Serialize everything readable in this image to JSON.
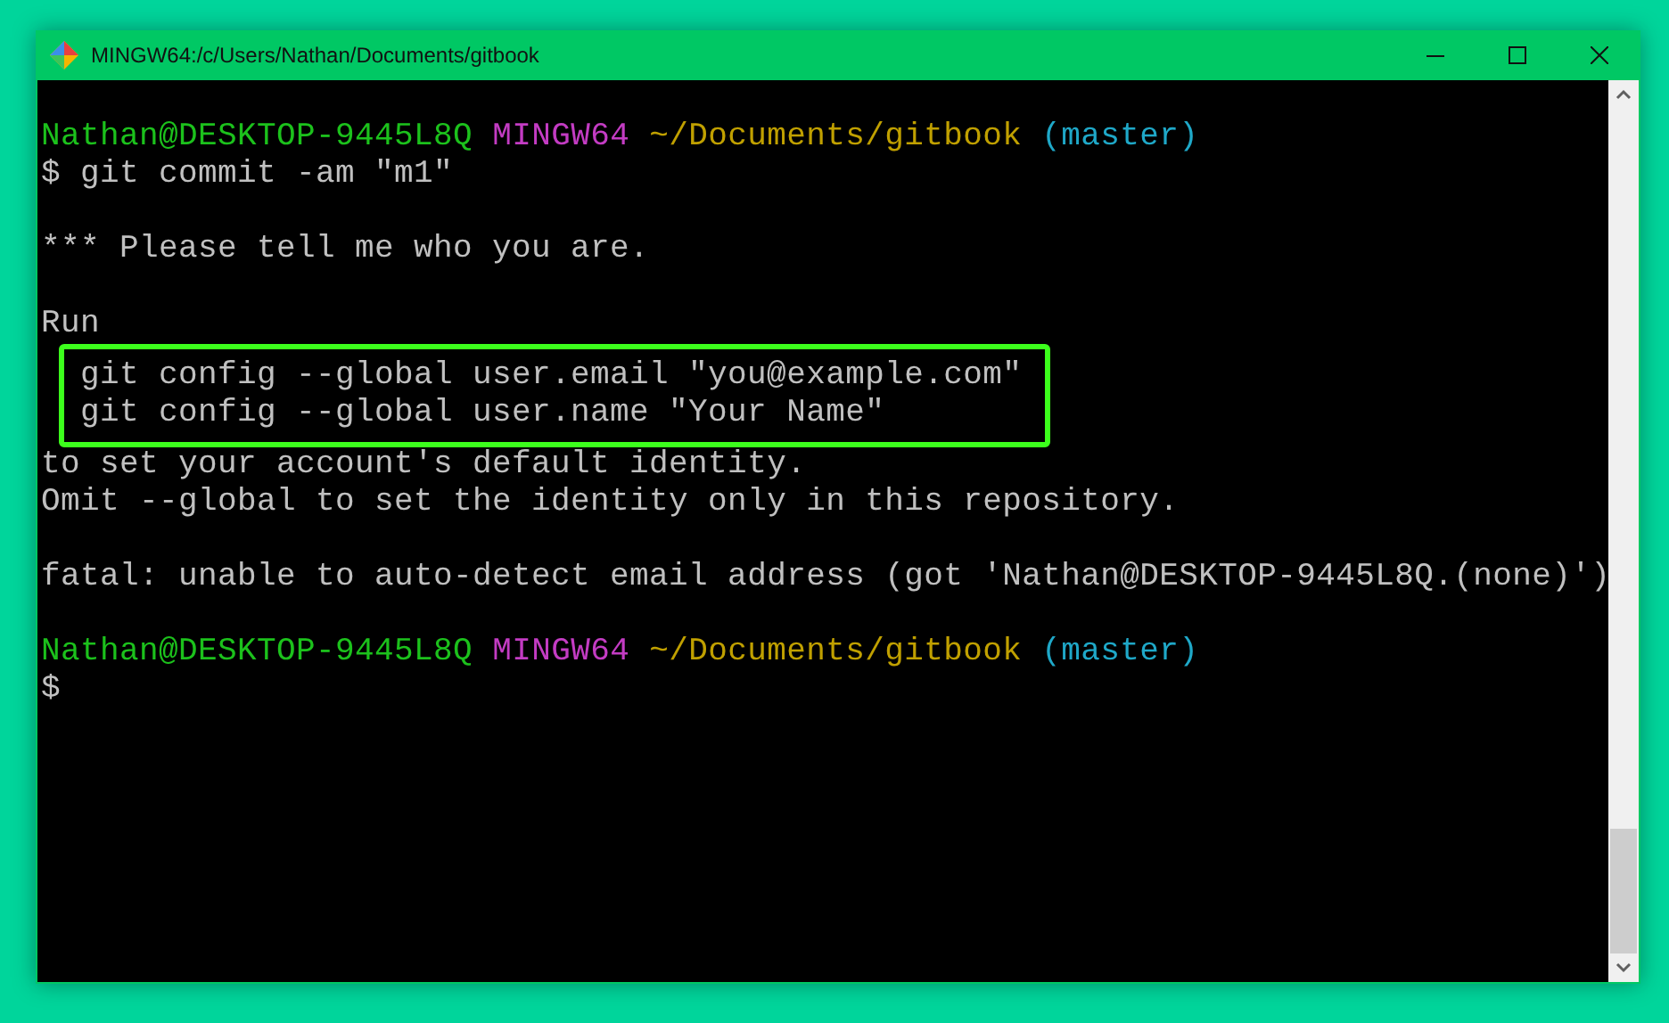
{
  "window": {
    "title": "MINGW64:/c/Users/Nathan/Documents/gitbook"
  },
  "terminal": {
    "lines": [
      {
        "kind": "prompt",
        "user": "Nathan@DESKTOP-9445L8Q",
        "shell": "MINGW64",
        "path": "~/Documents/gitbook",
        "branch": "(master)"
      },
      {
        "kind": "text",
        "text": "$ git commit -am \"m1\""
      },
      {
        "kind": "blank"
      },
      {
        "kind": "text",
        "text": "*** Please tell me who you are."
      },
      {
        "kind": "blank"
      },
      {
        "kind": "text",
        "text": "Run"
      },
      {
        "kind": "boxed",
        "lines": [
          "git config --global user.email \"you@example.com\"",
          "git config --global user.name \"Your Name\""
        ]
      },
      {
        "kind": "text",
        "text": "to set your account's default identity."
      },
      {
        "kind": "text",
        "text": "Omit --global to set the identity only in this repository."
      },
      {
        "kind": "blank"
      },
      {
        "kind": "text",
        "text": "fatal: unable to auto-detect email address (got 'Nathan@DESKTOP-9445L8Q.(none)')"
      },
      {
        "kind": "blank"
      },
      {
        "kind": "prompt",
        "user": "Nathan@DESKTOP-9445L8Q",
        "shell": "MINGW64",
        "path": "~/Documents/gitbook",
        "branch": "(master)"
      },
      {
        "kind": "text",
        "text": "$"
      }
    ]
  }
}
